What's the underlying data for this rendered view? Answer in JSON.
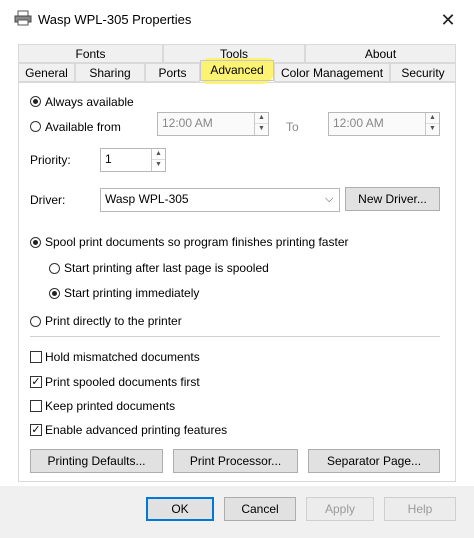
{
  "window": {
    "title": "Wasp WPL-305 Properties"
  },
  "tabs": {
    "row1": [
      "Fonts",
      "Tools",
      "About"
    ],
    "row2": [
      "General",
      "Sharing",
      "Ports",
      "Advanced",
      "Color Management",
      "Security"
    ],
    "active": "Advanced",
    "highlight_color": "#fdf26a"
  },
  "availability": {
    "always_label": "Always available",
    "from_label": "Available from",
    "from_time": "12:00 AM",
    "to_label": "To",
    "to_time": "12:00 AM",
    "selected": "always"
  },
  "priority": {
    "label": "Priority:",
    "value": "1"
  },
  "driver": {
    "label": "Driver:",
    "value": "Wasp WPL-305",
    "new_driver_label": "New Driver..."
  },
  "spool": {
    "spool_label": "Spool print documents so program finishes printing faster",
    "after_last_page_label": "Start printing after last page is spooled",
    "immediately_label": "Start printing immediately",
    "direct_label": "Print directly to the printer"
  },
  "options": [
    {
      "label": "Hold mismatched documents",
      "checked": false
    },
    {
      "label": "Print spooled documents first",
      "checked": true
    },
    {
      "label": "Keep printed documents",
      "checked": false
    },
    {
      "label": "Enable advanced printing features",
      "checked": true
    }
  ],
  "panel_buttons": {
    "defaults": "Printing Defaults...",
    "processor": "Print Processor...",
    "separator": "Separator Page..."
  },
  "dialog_buttons": {
    "ok": "OK",
    "cancel": "Cancel",
    "apply": "Apply",
    "help": "Help"
  }
}
